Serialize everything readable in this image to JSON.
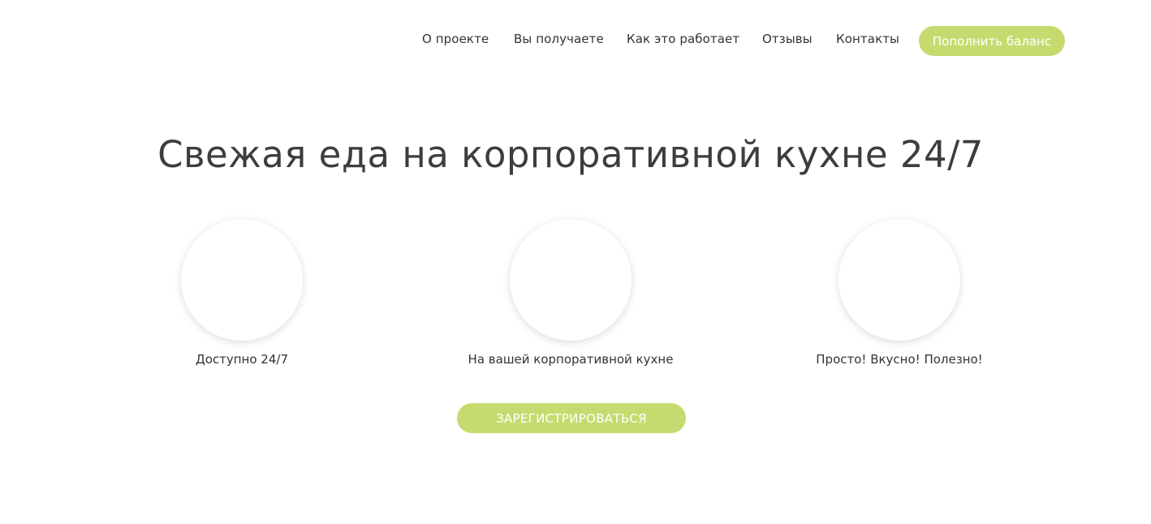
{
  "nav": {
    "items": [
      {
        "label": "О проекте"
      },
      {
        "label": "Вы получаете"
      },
      {
        "label": "Как это работает"
      },
      {
        "label": "Отзывы"
      },
      {
        "label": "Контакты"
      }
    ],
    "topup_label": "Пополнить баланс"
  },
  "hero": {
    "title": "Свежая еда на корпоративной кухне 24/7"
  },
  "features": [
    {
      "label": "Доступно 24/7"
    },
    {
      "label": "На вашей корпоративной кухне"
    },
    {
      "label": "Просто! Вкусно! Полезно!"
    }
  ],
  "cta": {
    "register_label": "ЗАРЕГИСТРИРОВАТЬСЯ"
  },
  "colors": {
    "accent": "#c6db6f",
    "text": "#333333",
    "background": "#ffffff"
  }
}
